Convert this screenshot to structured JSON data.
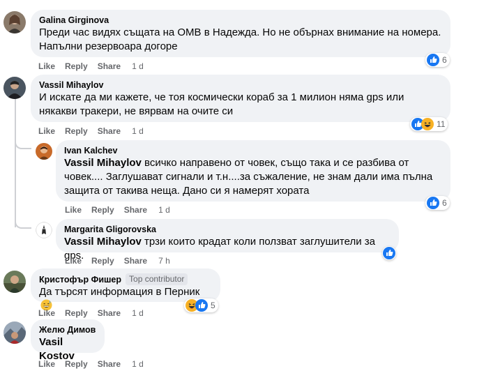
{
  "actions": {
    "like": "Like",
    "reply": "Reply",
    "share": "Share"
  },
  "comments": [
    {
      "author": "Galina Girginova",
      "text": "Преди час видях същата на ОМВ в Надежда. Но не обърнах внимание на номера. Напълни резервоара догоре",
      "time": "1 d",
      "reaction_count": "6",
      "reactions": [
        "like"
      ]
    },
    {
      "author": "Vassil Mihaylov",
      "text": "И искате да ми кажете, че тоя космически кораб за 1 милион няма gps или някакви тракери, не вярвам на очите си",
      "time": "1 d",
      "reaction_count": "11",
      "reactions": [
        "like",
        "haha"
      ]
    },
    {
      "author": "Ivan Kalchev",
      "mention": "Vassil Mihaylov",
      "text": " всичко направено от човек, също така и се разбива от човек.... Заглушават сигнали и т.н....за съжаление, не знам дали има пълна защита от такива неща. Дано си я намерят хората",
      "time": "1 d",
      "reaction_count": "6",
      "reactions": [
        "like"
      ]
    },
    {
      "author": "Margarita Gligorovska",
      "mention": "Vassil Mihaylov",
      "text": " трзи които крадат коли ползват заглушители за gps.",
      "time": "7 h",
      "reactions": [
        "like"
      ]
    },
    {
      "author": "Кристофър Фишер",
      "badge": "Top contributor",
      "text": "Да търсят информация в Перник",
      "time": "1 d",
      "reaction_count": "5",
      "reactions": [
        "haha",
        "like"
      ],
      "text_emoji": "grinning-sweat-emoji"
    },
    {
      "author": "Желю Димов",
      "mention": "Vasil Kostov",
      "time": "1 d"
    }
  ],
  "colors": {
    "like_blue": "#1877f2",
    "haha_yellow": "#f7b125",
    "bubble_bg": "#f0f2f5",
    "meta_gray": "#65676b"
  }
}
